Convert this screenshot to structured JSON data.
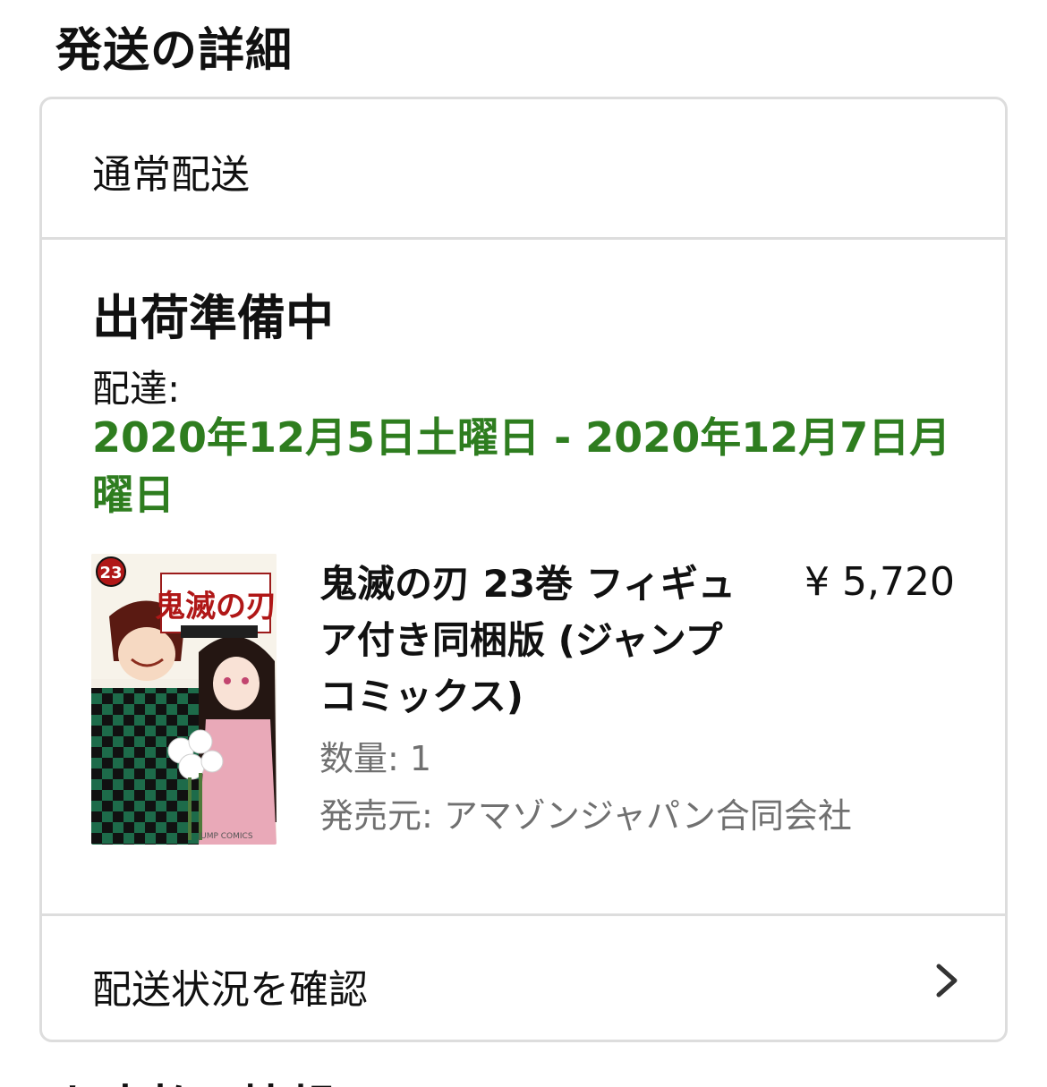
{
  "page": {
    "section_title": "発送の詳細",
    "next_section_title": "お支払い情報"
  },
  "shipment": {
    "method": "通常配送",
    "status": "出荷準備中",
    "delivery_label": "配達:",
    "delivery_range": "2020年12月5日土曜日 - 2020年12月7日月曜日"
  },
  "item": {
    "title": "鬼滅の刃 23巻 フィギュア付き同梱版 (ジャンプコミックス)",
    "price": "¥ 5,720",
    "quantity_label": "数量:",
    "quantity": "1",
    "seller_label": "発売元:",
    "seller": "アマゾンジャパン合同会社",
    "cover": {
      "volume": "23",
      "series_logo": "鬼滅の刃",
      "imprint": "JUMP COMICS"
    }
  },
  "tracking": {
    "label": "配送状況を確認",
    "icon": "chevron-right-icon"
  },
  "colors": {
    "delivery_green": "#2e7d1f",
    "border": "#dddddd",
    "secondary_text": "#707070"
  }
}
